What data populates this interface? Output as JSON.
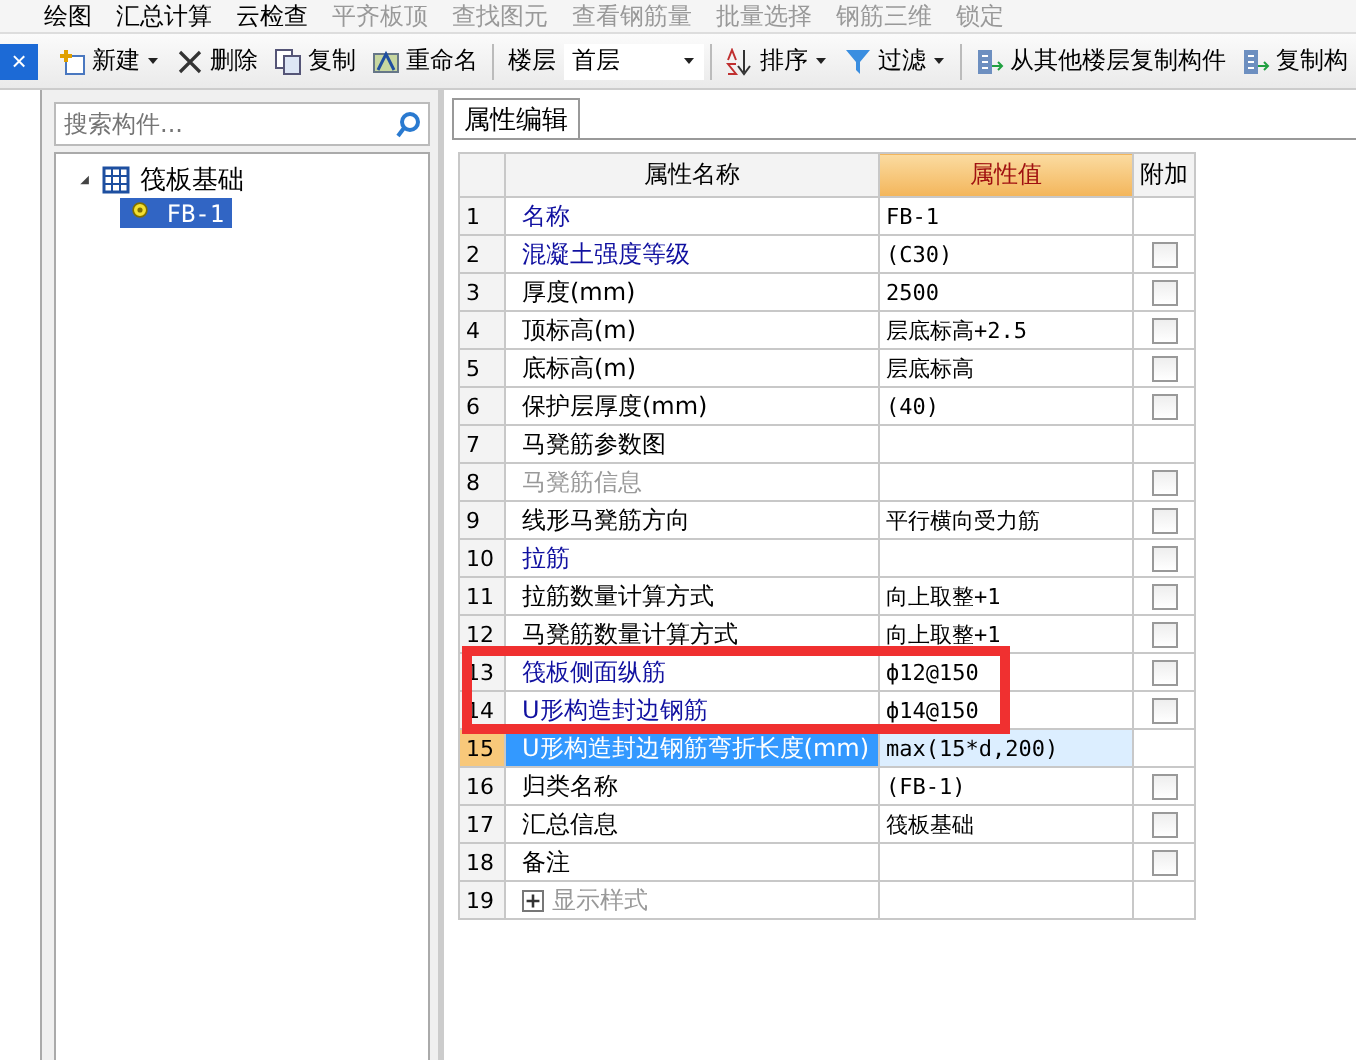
{
  "top_toolbar": [
    {
      "label": "绘图",
      "disabled": false
    },
    {
      "label": "汇总计算",
      "disabled": false
    },
    {
      "label": "云检查",
      "disabled": false
    },
    {
      "label": "平齐板顶",
      "disabled": true
    },
    {
      "label": "查找图元",
      "disabled": true
    },
    {
      "label": "查看钢筋量",
      "disabled": true
    },
    {
      "label": "批量选择",
      "disabled": true
    },
    {
      "label": "钢筋三维",
      "disabled": true
    },
    {
      "label": "锁定",
      "disabled": true
    }
  ],
  "close_tab": {
    "label": "×"
  },
  "toolbar": {
    "new": "新建",
    "delete": "删除",
    "copy": "复制",
    "rename": "重命名",
    "floor_label": "楼层",
    "floor": "首层",
    "sort": "排序",
    "filter": "过滤",
    "copy_from_floor": "从其他楼层复制构件",
    "copy_component": "复制构"
  },
  "search": {
    "placeholder": "搜索构件..."
  },
  "tree": [
    {
      "label": "筏板基础",
      "expanded": true,
      "children": [
        {
          "label": "FB-1",
          "selected": true
        }
      ]
    }
  ],
  "panel_tab": {
    "label": "属性编辑",
    "selected": true
  },
  "table": {
    "columns": [
      "属性名称",
      "属性值",
      "附加"
    ],
    "rows": [
      {
        "num": "1",
        "name": "名称",
        "value": "FB-1",
        "kind": "public",
        "selected": false,
        "boxed": false
      },
      {
        "num": "2",
        "name": "混凝土强度等级",
        "value": "(C30)",
        "kind": "public",
        "selected": false,
        "boxed": false,
        "checked": false
      },
      {
        "num": "3",
        "name": "厚度(mm)",
        "value": "2500",
        "kind": "private",
        "selected": false,
        "boxed": false,
        "checked": false
      },
      {
        "num": "4",
        "name": "顶标高(m)",
        "value": "层底标高+2.5",
        "kind": "private",
        "selected": false,
        "boxed": false,
        "checked": false
      },
      {
        "num": "5",
        "name": "底标高(m)",
        "value": "层底标高",
        "kind": "private",
        "selected": false,
        "boxed": false,
        "checked": false
      },
      {
        "num": "6",
        "name": "保护层厚度(mm)",
        "value": "(40)",
        "kind": "private",
        "selected": false,
        "boxed": false,
        "checked": false
      },
      {
        "num": "7",
        "name": "马凳筋参数图",
        "value": "",
        "kind": "private",
        "selected": false,
        "boxed": false
      },
      {
        "num": "8",
        "name": "马凳筋信息",
        "value": "",
        "kind": "disabled",
        "selected": false,
        "boxed": false,
        "checked": false
      },
      {
        "num": "9",
        "name": "线形马凳筋方向",
        "value": "平行横向受力筋",
        "kind": "private",
        "selected": false,
        "boxed": false,
        "checked": false
      },
      {
        "num": "10",
        "name": "拉筋",
        "value": "",
        "kind": "public",
        "selected": false,
        "boxed": false,
        "checked": false
      },
      {
        "num": "11",
        "name": "拉筋数量计算方式",
        "value": "向上取整+1",
        "kind": "private",
        "selected": false,
        "boxed": false,
        "checked": false
      },
      {
        "num": "12",
        "name": "马凳筋数量计算方式",
        "value": "向上取整+1",
        "kind": "private",
        "selected": false,
        "boxed": false,
        "checked": false
      },
      {
        "num": "13",
        "name": "筏板侧面纵筋",
        "value": "ф12@150",
        "kind": "public",
        "selected": false,
        "boxed": true,
        "checked": false
      },
      {
        "num": "14",
        "name": "U形构造封边钢筋",
        "value": "ф14@150",
        "kind": "public",
        "selected": false,
        "boxed": true,
        "checked": false
      },
      {
        "num": "15",
        "name": "U形构造封边钢筋弯折长度(mm)",
        "value": "max(15*d,200)",
        "kind": "private",
        "selected": true,
        "boxed": false
      },
      {
        "num": "16",
        "name": "归类名称",
        "value": "(FB-1)",
        "kind": "private",
        "selected": false,
        "boxed": false,
        "checked": false
      },
      {
        "num": "17",
        "name": "汇总信息",
        "value": "筏板基础",
        "kind": "private",
        "selected": false,
        "boxed": false,
        "checked": false
      },
      {
        "num": "18",
        "name": "备注",
        "value": "",
        "kind": "private",
        "selected": false,
        "boxed": false,
        "checked": false
      },
      {
        "num": "19",
        "name": "显示样式",
        "value": "",
        "kind": "group",
        "selected": false,
        "boxed": false,
        "expanded": false
      }
    ]
  }
}
